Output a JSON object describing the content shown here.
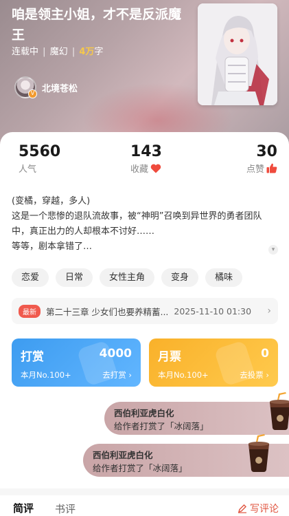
{
  "book": {
    "title": "咱是领主小姐，才不是反派魔王",
    "status": "连载中",
    "genre": "魔幻",
    "word_count_number": "4万",
    "word_count_unit": "字",
    "separator": "|"
  },
  "author": {
    "name": "北境苍松",
    "badge": "V"
  },
  "stats": {
    "popularity": {
      "value": "5560",
      "label": "人气"
    },
    "favorites": {
      "value": "143",
      "label": "收藏"
    },
    "likes": {
      "value": "30",
      "label": "点赞"
    }
  },
  "description": {
    "lines": [
      "(变橘，穿越，多人)",
      "这是一个悲惨的退队流故事，被“神明”召唤到异世界的勇者团队中，真正出力的人却根本不讨好……",
      "等等，剧本拿错了…"
    ],
    "expand_icon": "chevron-down-icon"
  },
  "tags": [
    "恋爱",
    "日常",
    "女性主角",
    "变身",
    "橘味"
  ],
  "latest_chapter": {
    "badge": "最新",
    "title": "第二十三章 少女们也要养精蓄...",
    "date": "2025-11-10 01:30",
    "arrow": "›"
  },
  "tip_card": {
    "title": "打赏",
    "amount": "4000",
    "monthly": "本月No.100+",
    "action": "去打赏"
  },
  "ticket_card": {
    "title": "月票",
    "amount": "0",
    "monthly": "本月No.100+",
    "action": "去投票"
  },
  "rewards": [
    {
      "user": "西伯利亚虎白化",
      "text": "给作者打赏了「冰阔落」"
    },
    {
      "user": "西伯利亚虎白化",
      "text": "给作者打赏了「冰阔落」"
    }
  ],
  "bottom_tabs": {
    "brief": "简评",
    "review": "书评",
    "write": "写评论"
  },
  "colors": {
    "accent_red": "#e0543f",
    "new_badge": "#f05a4e",
    "tip_blue": "#3d9cf0",
    "ticket_orange": "#f9b12a",
    "word_count": "#f6c84a"
  }
}
